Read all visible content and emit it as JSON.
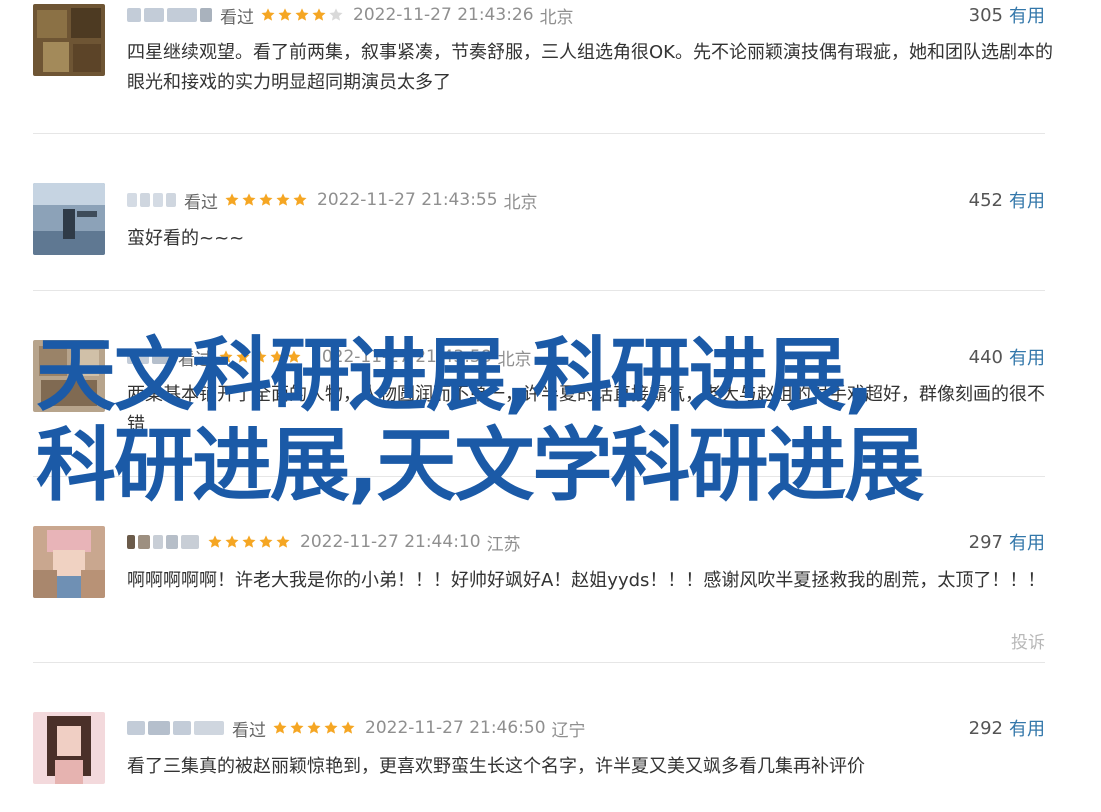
{
  "colors": {
    "link": "#3377aa",
    "star": "#f5a623",
    "overlay_text": "#1b5aa7",
    "divider": "#e6e6e6"
  },
  "labels": {
    "watched": "看过",
    "useful": "有用",
    "report": "投诉"
  },
  "reviews": [
    {
      "watched": "看过",
      "rating": 4,
      "time": "2022-11-27 21:43:26",
      "location": "北京",
      "votes": "305",
      "text": "四星继续观望。看了前两集，叙事紧凑，节奏舒服，三人组选角很OK。先不论丽颖演技偶有瑕疵，她和团队选剧本的眼光和接戏的实力明显超同期演员太多了"
    },
    {
      "watched": "看过",
      "rating": 5,
      "time": "2022-11-27 21:43:55",
      "location": "北京",
      "votes": "452",
      "text": "蛮好看的~~~"
    },
    {
      "watched": "看过",
      "rating": 5,
      "time": "2022-11-27 21:43:58",
      "location": "北京",
      "votes": "440",
      "text": "两集基本铺开了全面的人物，人物圆润而不单一，许半夏的话直接霸气，老大与赵姐的对手戏超好，群像刻画的很不错"
    },
    {
      "watched": "",
      "rating": 5,
      "time": "2022-11-27 21:44:10",
      "location": "江苏",
      "votes": "297",
      "text": "啊啊啊啊啊！许老大我是你的小弟！！！好帅好飒好A！赵姐yyds！！！感谢风吹半夏拯救我的剧荒，太顶了！！！"
    },
    {
      "watched": "看过",
      "rating": 5,
      "time": "2022-11-27 21:46:50",
      "location": "辽宁",
      "votes": "292",
      "text": "看了三集真的被赵丽颖惊艳到，更喜欢野蛮生长这个名字，许半夏又美又飒多看几集再补评价"
    }
  ],
  "overlay": {
    "line1": "天文科研进展,科研进展,",
    "line2": "科研进展,天文学科研进展"
  }
}
